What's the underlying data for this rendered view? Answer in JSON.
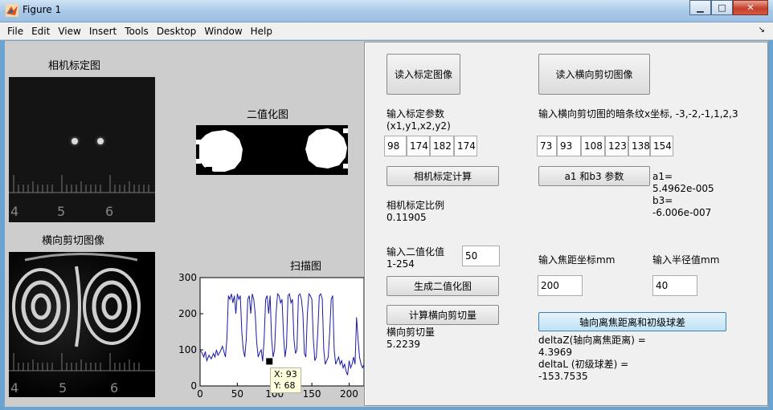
{
  "window": {
    "title": "Figure 1",
    "buttons": {
      "minimize": "▁",
      "maximize": "□",
      "close": "✕"
    }
  },
  "menu": [
    "File",
    "Edit",
    "View",
    "Insert",
    "Tools",
    "Desktop",
    "Window",
    "Help"
  ],
  "figure": {
    "calib_title": "相机标定图",
    "binary_title": "二值化图",
    "shear_title": "横向剪切图像",
    "scan_title": "扫描图",
    "ruler_digits": [
      "4",
      "5",
      "6"
    ]
  },
  "scan_chart": {
    "chart_data": {
      "type": "line",
      "title": "扫描图",
      "xlim": [
        0,
        220
      ],
      "ylim": [
        0,
        300
      ],
      "xticks": [
        0,
        50,
        100,
        150,
        200
      ],
      "yticks": [
        0,
        100,
        200,
        300
      ],
      "x": [
        0,
        3,
        5,
        7,
        9,
        12,
        15,
        18,
        20,
        22,
        24,
        27,
        30,
        32,
        34,
        36,
        38,
        40,
        42,
        44,
        46,
        48,
        50,
        52,
        54,
        56,
        58,
        60,
        62,
        64,
        66,
        68,
        70,
        72,
        74,
        76,
        78,
        80,
        82,
        84,
        86,
        88,
        90,
        92,
        94,
        96,
        98,
        100,
        102,
        104,
        106,
        108,
        110,
        112,
        114,
        116,
        118,
        120,
        122,
        124,
        126,
        128,
        130,
        132,
        134,
        136,
        138,
        140,
        142,
        144,
        146,
        148,
        150,
        152,
        154,
        156,
        158,
        160,
        162,
        164,
        166,
        168,
        170,
        172,
        174,
        176,
        178,
        180,
        182,
        184,
        186,
        188,
        190,
        192,
        194,
        196,
        198,
        200,
        202,
        204,
        206,
        208,
        210,
        212,
        214,
        216,
        218,
        220
      ],
      "y": [
        100,
        90,
        80,
        95,
        70,
        85,
        75,
        90,
        80,
        100,
        85,
        95,
        110,
        95,
        80,
        130,
        250,
        240,
        255,
        230,
        250,
        200,
        255,
        240,
        250,
        150,
        100,
        80,
        130,
        240,
        250,
        200,
        255,
        240,
        200,
        120,
        80,
        93,
        100,
        68,
        130,
        240,
        250,
        200,
        250,
        130,
        80,
        100,
        200,
        255,
        250,
        230,
        240,
        140,
        80,
        110,
        250,
        255,
        230,
        240,
        130,
        90,
        100,
        250,
        255,
        240,
        200,
        90,
        80,
        200,
        255,
        250,
        240,
        130,
        70,
        80,
        150,
        250,
        255,
        240,
        100,
        60,
        70,
        80,
        150,
        240,
        250,
        100,
        60,
        70,
        80,
        60,
        70,
        50,
        60,
        40,
        30,
        70,
        50,
        60,
        80,
        60,
        190,
        130,
        80,
        60,
        50,
        60
      ]
    },
    "datatip": {
      "x": "X: 93",
      "y": "Y: 68"
    }
  },
  "panel": {
    "btn_read_calib": "读入标定图像",
    "btn_read_shear": "读入横向剪切图像",
    "lbl_calib_params": "输入标定参数\n(x1,y1,x2,y2)",
    "lbl_fringe_x": "输入横向剪切图的暗条纹x坐标, -3,-2,-1,1,2,3",
    "calib_params": [
      "98",
      "174",
      "182",
      "174"
    ],
    "fringe_x": [
      "73",
      "93",
      "108",
      "123",
      "138",
      "154"
    ],
    "btn_calib_calc": "相机标定计算",
    "btn_a1b3": "a1 和b3 参数",
    "ab_result": "a1=\n5.4962e-005\nb3=\n-6.006e-007",
    "lbl_calib_ratio": "相机标定比例\n0.11905",
    "lbl_threshold": "输入二值化值\n1-254",
    "threshold_value": "50",
    "lbl_focal": "输入焦距坐标mm",
    "lbl_radius": "输入半径值mm",
    "focal_value": "200",
    "radius_value": "40",
    "btn_gen_binary": "生成二值化图",
    "btn_calc_shear": "计算横向剪切量",
    "btn_axial": "轴向离焦距离和初级球差",
    "lbl_shear_result": "横向剪切量\n5.2239",
    "lbl_axial_result": "deltaZ(轴向离焦距离) =\n4.3969\ndeltaL (初级球差) =\n-153.7535"
  }
}
